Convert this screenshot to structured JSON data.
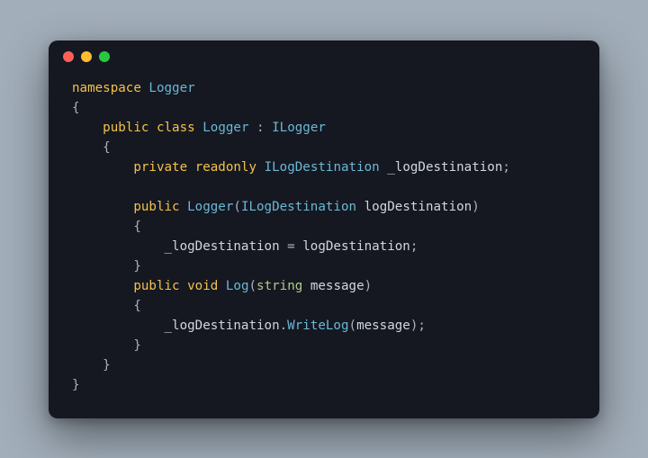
{
  "titlebar": {
    "dots": {
      "red": "#ff5f56",
      "yellow": "#ffbd2e",
      "green": "#27c93f"
    }
  },
  "code": {
    "kw_namespace": "namespace",
    "ns_name": "Logger",
    "brace_open": "{",
    "brace_close": "}",
    "kw_public": "public",
    "kw_class": "class",
    "cls_name": "Logger",
    "colon": " : ",
    "iface": "ILogger",
    "kw_private": "private",
    "kw_readonly": "readonly",
    "field_type": "ILogDestination",
    "field_name": "_logDestination",
    "semi": ";",
    "ctor_name": "Logger",
    "paren_open": "(",
    "paren_close": ")",
    "param_type": "ILogDestination",
    "param_name": "logDestination",
    "assign_lhs": "_logDestination",
    "eq": " = ",
    "assign_rhs": "logDestination",
    "kw_void": "void",
    "method_name": "Log",
    "log_param_type": "string",
    "log_param_name": "message",
    "call_target": "_logDestination",
    "dot": ".",
    "call_method": "WriteLog",
    "call_arg": "message"
  }
}
